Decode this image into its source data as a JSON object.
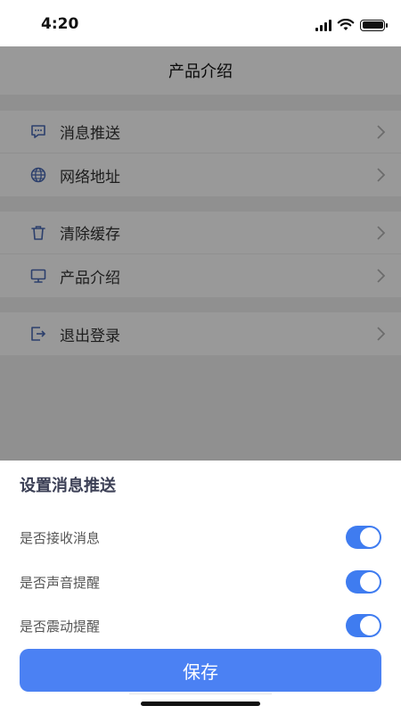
{
  "status_bar": {
    "time": "4:20"
  },
  "header": {
    "title": "产品介绍"
  },
  "settings_groups": [
    {
      "items": [
        {
          "label": "消息推送",
          "icon": "message-icon"
        },
        {
          "label": "网络地址",
          "icon": "globe-icon"
        }
      ]
    },
    {
      "items": [
        {
          "label": "清除缓存",
          "icon": "trash-icon"
        },
        {
          "label": "产品介绍",
          "icon": "monitor-icon"
        }
      ]
    },
    {
      "items": [
        {
          "label": "退出登录",
          "icon": "logout-icon"
        }
      ]
    }
  ],
  "sheet": {
    "title": "设置消息推送",
    "options": [
      {
        "label": "是否接收消息",
        "enabled": true
      },
      {
        "label": "是否声音提醒",
        "enabled": true
      },
      {
        "label": "是否震动提醒",
        "enabled": true
      }
    ],
    "save_label": "保存"
  },
  "colors": {
    "accent": "#3f7cf0",
    "button": "#4b81f3",
    "icon": "#4a6ab5"
  }
}
